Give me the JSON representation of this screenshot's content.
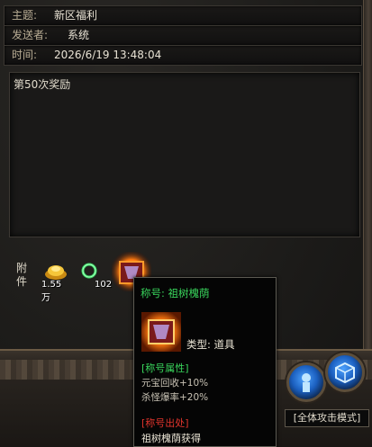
{
  "mail": {
    "subject_label": "主题:",
    "subject_value": "新区福利",
    "sender_label": "发送者:",
    "sender_value": "系统",
    "time_label": "时间:",
    "time_value": "2026/6/19 13:48:04",
    "body": "第50次奖励",
    "attach_label": "附件"
  },
  "attachments": [
    {
      "icon": "gold-ingot-icon",
      "count": "1.55万"
    },
    {
      "icon": "jade-ring-icon",
      "count": "102"
    },
    {
      "icon": "title-item-icon",
      "count": ""
    }
  ],
  "tooltip": {
    "title": "称号: 祖树槐荫",
    "type": "类型: 道具",
    "attr_header": "[称号属性]",
    "attrs": [
      "元宝回收+10%",
      "杀怪爆率+20%"
    ],
    "source_header": "[称号出处]",
    "source": "祖树槐荫获得"
  },
  "hud": {
    "mode": "[全体攻击模式]"
  },
  "colors": {
    "green_text": "#39d65c",
    "red_text": "#e0342c"
  }
}
